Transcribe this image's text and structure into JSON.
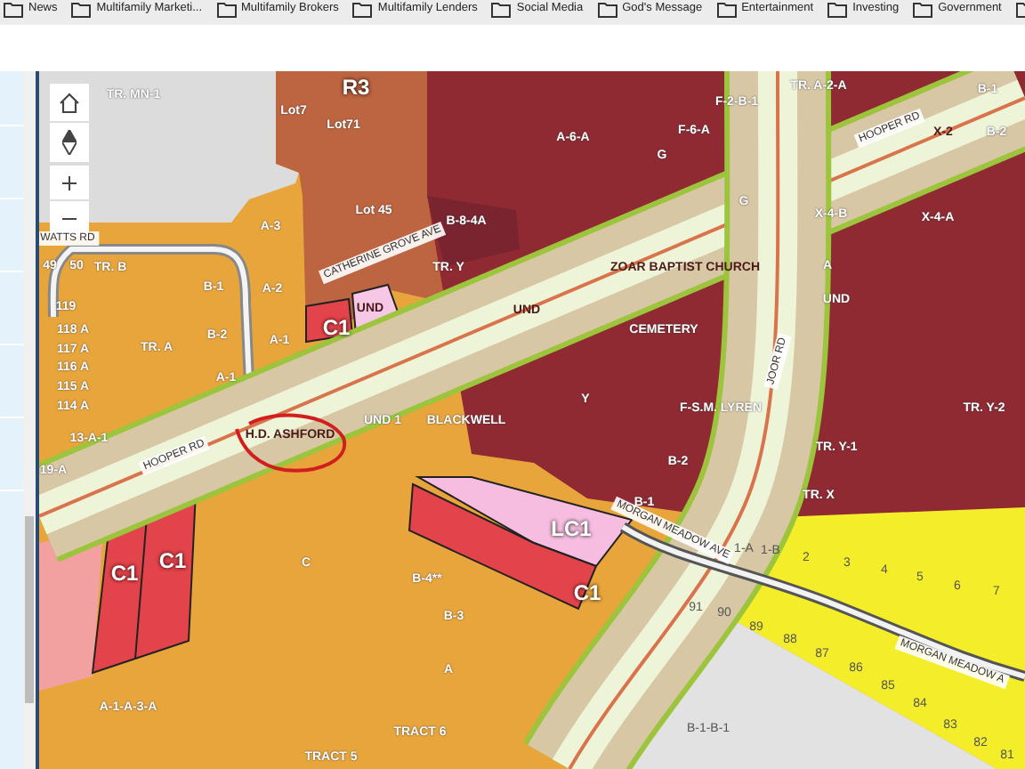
{
  "bookmarks": [
    {
      "label": "News"
    },
    {
      "label": "Multifamily Marketi..."
    },
    {
      "label": "Multifamily Brokers"
    },
    {
      "label": "Multifamily Lenders"
    },
    {
      "label": "Social Media"
    },
    {
      "label": "God's Message"
    },
    {
      "label": "Entertainment"
    },
    {
      "label": "Investing"
    },
    {
      "label": "Government"
    }
  ],
  "map": {
    "labels": [
      {
        "text": "TR. MN-1",
        "kind": "parcel"
      },
      {
        "text": "R3",
        "kind": "zone"
      },
      {
        "text": "Lot7",
        "kind": "parcel"
      },
      {
        "text": "Lot71",
        "kind": "parcel"
      },
      {
        "text": "Lot 45",
        "kind": "parcel"
      },
      {
        "text": "WATTS RD",
        "kind": "street"
      },
      {
        "text": "A-3",
        "kind": "parcel"
      },
      {
        "text": "B-8-4A",
        "kind": "parcel"
      },
      {
        "text": "CATHERINE GROVE AVE",
        "kind": "street"
      },
      {
        "text": "49",
        "kind": "parcel"
      },
      {
        "text": "50",
        "kind": "parcel"
      },
      {
        "text": "TR. B",
        "kind": "parcel"
      },
      {
        "text": "B-1",
        "kind": "parcel"
      },
      {
        "text": "A-2",
        "kind": "parcel"
      },
      {
        "text": "TR. Y",
        "kind": "parcel"
      },
      {
        "text": "119",
        "kind": "parcel"
      },
      {
        "text": "UND",
        "kind": "parcel"
      },
      {
        "text": "118 A",
        "kind": "parcel"
      },
      {
        "text": "C1",
        "kind": "zone"
      },
      {
        "text": "117 A",
        "kind": "parcel"
      },
      {
        "text": "116 A",
        "kind": "parcel"
      },
      {
        "text": "TR. A",
        "kind": "parcel"
      },
      {
        "text": "B-2",
        "kind": "parcel"
      },
      {
        "text": "A-1",
        "kind": "parcel"
      },
      {
        "text": "115 A",
        "kind": "parcel"
      },
      {
        "text": "A-1",
        "kind": "parcel"
      },
      {
        "text": "114 A",
        "kind": "parcel"
      },
      {
        "text": "UND 1",
        "kind": "parcel"
      },
      {
        "text": "BLACKWELL",
        "kind": "parcel"
      },
      {
        "text": "13-A-1",
        "kind": "parcel"
      },
      {
        "text": "H.D. ASHFORD",
        "kind": "parcel"
      },
      {
        "text": "HOOPER RD",
        "kind": "street"
      },
      {
        "text": "19-A",
        "kind": "parcel"
      },
      {
        "text": "C",
        "kind": "parcel"
      },
      {
        "text": "C1",
        "kind": "zone"
      },
      {
        "text": "C1",
        "kind": "zone"
      },
      {
        "text": "B-4**",
        "kind": "parcel"
      },
      {
        "text": "B-3",
        "kind": "parcel"
      },
      {
        "text": "A",
        "kind": "parcel"
      },
      {
        "text": "A-1-A-3-A",
        "kind": "parcel"
      },
      {
        "text": "TRACT 6",
        "kind": "parcel"
      },
      {
        "text": "TRACT 5",
        "kind": "parcel"
      },
      {
        "text": "TR. A-2-A",
        "kind": "parcel"
      },
      {
        "text": "F-2-B-1",
        "kind": "parcel"
      },
      {
        "text": "B-1",
        "kind": "parcel"
      },
      {
        "text": "A-6-A",
        "kind": "parcel"
      },
      {
        "text": "F-6-A",
        "kind": "parcel"
      },
      {
        "text": "HOOPER RD",
        "kind": "street"
      },
      {
        "text": "X-2",
        "kind": "parcel"
      },
      {
        "text": "B-2",
        "kind": "parcel"
      },
      {
        "text": "G",
        "kind": "parcel"
      },
      {
        "text": "G",
        "kind": "parcel"
      },
      {
        "text": "X-4-B",
        "kind": "parcel"
      },
      {
        "text": "X-4-A",
        "kind": "parcel"
      },
      {
        "text": "ZOAR BAPTIST CHURCH",
        "kind": "parcel"
      },
      {
        "text": "A",
        "kind": "parcel"
      },
      {
        "text": "UND",
        "kind": "parcel"
      },
      {
        "text": "UND",
        "kind": "parcel"
      },
      {
        "text": "CEMETERY",
        "kind": "parcel"
      },
      {
        "text": "JOOR RD",
        "kind": "street"
      },
      {
        "text": "Y",
        "kind": "parcel"
      },
      {
        "text": "F-S.M. LYREN",
        "kind": "parcel"
      },
      {
        "text": "TR. Y-2",
        "kind": "parcel"
      },
      {
        "text": "B-2",
        "kind": "parcel"
      },
      {
        "text": "TR. Y-1",
        "kind": "parcel"
      },
      {
        "text": "B-1",
        "kind": "parcel"
      },
      {
        "text": "TR. X",
        "kind": "parcel"
      },
      {
        "text": "LC1",
        "kind": "zone"
      },
      {
        "text": "MORGAN MEADOW AVE",
        "kind": "street"
      },
      {
        "text": "C1",
        "kind": "zone"
      },
      {
        "text": "1-A",
        "kind": "lot"
      },
      {
        "text": "1-B",
        "kind": "lot"
      },
      {
        "text": "2",
        "kind": "lot"
      },
      {
        "text": "3",
        "kind": "lot"
      },
      {
        "text": "4",
        "kind": "lot"
      },
      {
        "text": "5",
        "kind": "lot"
      },
      {
        "text": "6",
        "kind": "lot"
      },
      {
        "text": "7",
        "kind": "lot"
      },
      {
        "text": "91",
        "kind": "lot"
      },
      {
        "text": "90",
        "kind": "lot"
      },
      {
        "text": "89",
        "kind": "lot"
      },
      {
        "text": "88",
        "kind": "lot"
      },
      {
        "text": "87",
        "kind": "lot"
      },
      {
        "text": "86",
        "kind": "lot"
      },
      {
        "text": "85",
        "kind": "lot"
      },
      {
        "text": "84",
        "kind": "lot"
      },
      {
        "text": "83",
        "kind": "lot"
      },
      {
        "text": "82",
        "kind": "lot"
      },
      {
        "text": "81",
        "kind": "lot"
      },
      {
        "text": "B-1-B-1",
        "kind": "lot"
      },
      {
        "text": "MORGAN MEADOW A",
        "kind": "street"
      }
    ]
  }
}
